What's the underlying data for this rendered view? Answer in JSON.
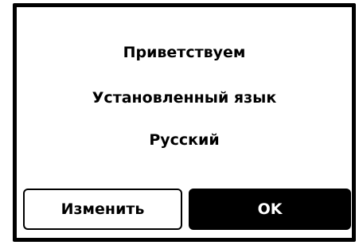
{
  "dialog": {
    "welcome": "Приветствуем",
    "language_label": "Установленный язык",
    "language_value": "Русский"
  },
  "buttons": {
    "change_label": "Изменить",
    "ok_label": "OK"
  },
  "colors": {
    "background": "#ffffff",
    "border": "#000000",
    "primary_button_bg": "#000000",
    "primary_button_text": "#ffffff"
  }
}
